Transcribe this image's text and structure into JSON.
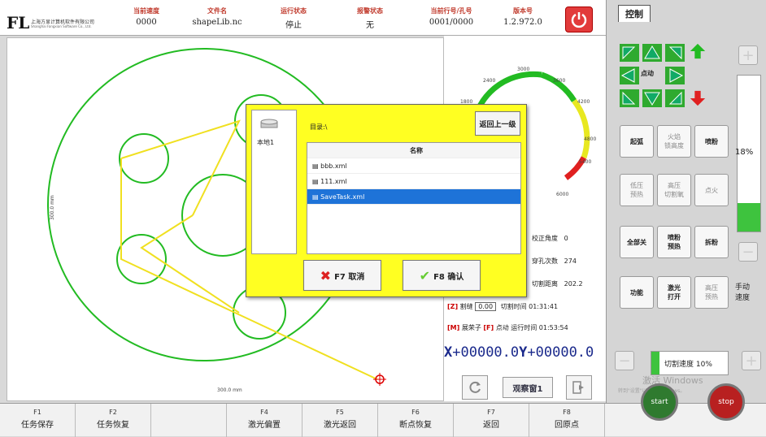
{
  "header": {
    "company_cn": "上海方显计算机软件有限公司",
    "company_en": "Shanghai Fangxian Software Co., Ltd.",
    "logo_text": "FL",
    "cols": [
      {
        "label": "当前速度",
        "value": "0000"
      },
      {
        "label": "文件名",
        "value": "shapeLib.nc"
      },
      {
        "label": "运行状态",
        "value": "停止"
      },
      {
        "label": "报警状态",
        "value": "无"
      },
      {
        "label": "当前行号/孔号",
        "value": "0001/0000"
      },
      {
        "label": "版本号",
        "value": "1.2.972.0"
      }
    ]
  },
  "canvas": {
    "width_label": "300.0 mm",
    "height_label": "300.0 mm"
  },
  "gauge": {
    "ticks": [
      "2400",
      "3000",
      "3600",
      "1800",
      "4200",
      "4800",
      "5400",
      "6000"
    ]
  },
  "status": {
    "rows": [
      {
        "label": "校正角度",
        "value": "0"
      },
      {
        "label": "穿孔次数",
        "value": "274"
      },
      {
        "label": "切割距离",
        "value": "202.2"
      }
    ],
    "z_label": "[Z]",
    "z_text": "割缝",
    "z_value": "0.00",
    "cut_time_label": "切割时间",
    "cut_time": "01:31:41",
    "m_label": "[M]",
    "m_text": "展荣子",
    "f_label": "[F]",
    "f_text": "点动",
    "run_time_label": "运行时间",
    "run_time": "01:53:54"
  },
  "coords": {
    "x_label": "X",
    "x_value": "+00000.0",
    "y_label": "Y",
    "y_value": "+00000.0"
  },
  "side_buttons": {
    "window": "观察窗1"
  },
  "dialog": {
    "location": "本地1",
    "path": "目录:\\",
    "back": "返回上一级",
    "column": "名称",
    "files": [
      "bbb.xml",
      "111.xml",
      "SaveTask.xml"
    ],
    "cancel": "F7 取消",
    "confirm": "F8 确认"
  },
  "fkeys": [
    {
      "key": "F1",
      "label": "任务保存"
    },
    {
      "key": "F2",
      "label": "任务恢复"
    },
    {
      "key": "",
      "label": ""
    },
    {
      "key": "F4",
      "label": "激光偏置"
    },
    {
      "key": "F5",
      "label": "激光返回"
    },
    {
      "key": "F6",
      "label": "断点恢复"
    },
    {
      "key": "F7",
      "label": "返回"
    },
    {
      "key": "F8",
      "label": "回原点"
    }
  ],
  "control": {
    "tab": "控制",
    "jog": "点动",
    "buttons": [
      {
        "label": "起弧"
      },
      {
        "label": "火焰\n锁高度"
      },
      {
        "label": "喷粉"
      },
      {
        "label": "低压\n预热"
      },
      {
        "label": "高压\n切割氧"
      },
      {
        "label": "点火"
      },
      {
        "label": "全部关"
      },
      {
        "label": "喷粉\n预热"
      },
      {
        "label": "拆粉"
      },
      {
        "label": "功能"
      },
      {
        "label": "激光\n打开"
      },
      {
        "label": "高压\n预热"
      }
    ],
    "percent": "18%",
    "manual_speed": "手动\n速度",
    "cut_speed": "切割速度 10%",
    "start": "start",
    "stop": "stop",
    "watermark1": "激活 Windows",
    "watermark2": "转到\"设置\"以激活 Windows。"
  }
}
